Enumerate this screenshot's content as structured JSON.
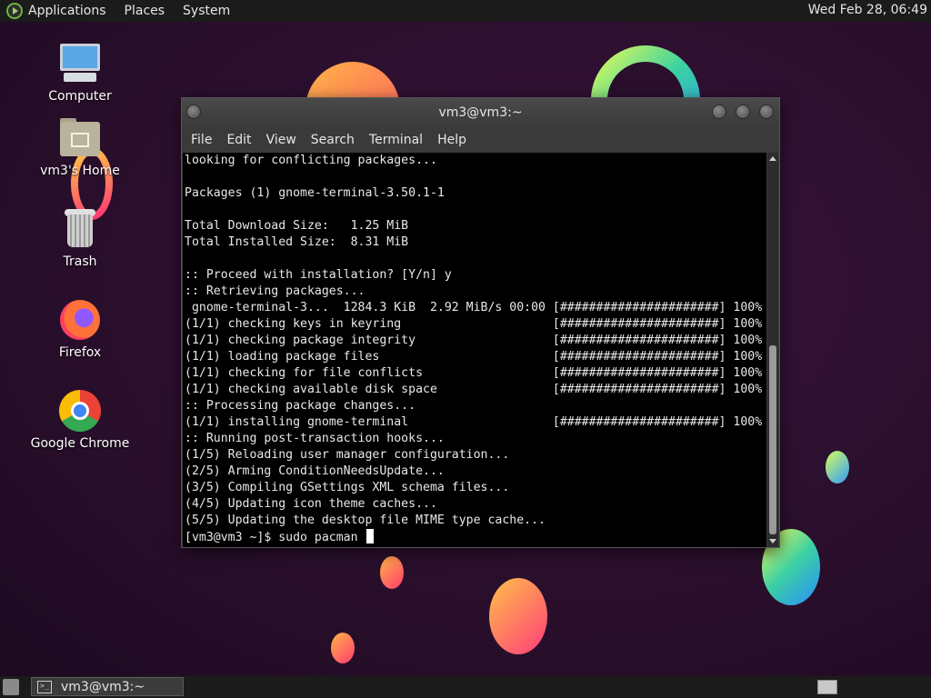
{
  "top_panel": {
    "menus": [
      "Applications",
      "Places",
      "System"
    ],
    "clock": "Wed Feb 28, 06:49"
  },
  "desktop_icons": [
    {
      "label": "Computer",
      "icon": "computer-icon"
    },
    {
      "label": "vm3's Home",
      "icon": "home-folder-icon"
    },
    {
      "label": "Trash",
      "icon": "trash-icon"
    },
    {
      "label": "Firefox",
      "icon": "firefox-icon"
    },
    {
      "label": "Google Chrome",
      "icon": "chrome-icon"
    }
  ],
  "terminal": {
    "title": "vm3@vm3:~",
    "menu": [
      "File",
      "Edit",
      "View",
      "Search",
      "Terminal",
      "Help"
    ],
    "lines": [
      "looking for conflicting packages...",
      "",
      "Packages (1) gnome-terminal-3.50.1-1",
      "",
      "Total Download Size:   1.25 MiB",
      "Total Installed Size:  8.31 MiB",
      "",
      ":: Proceed with installation? [Y/n] y",
      ":: Retrieving packages...",
      " gnome-terminal-3...  1284.3 KiB  2.92 MiB/s 00:00 [######################] 100%",
      "(1/1) checking keys in keyring                     [######################] 100%",
      "(1/1) checking package integrity                   [######################] 100%",
      "(1/1) loading package files                        [######################] 100%",
      "(1/1) checking for file conflicts                  [######################] 100%",
      "(1/1) checking available disk space                [######################] 100%",
      ":: Processing package changes...",
      "(1/1) installing gnome-terminal                    [######################] 100%",
      ":: Running post-transaction hooks...",
      "(1/5) Reloading user manager configuration...",
      "(2/5) Arming ConditionNeedsUpdate...",
      "(3/5) Compiling GSettings XML schema files...",
      "(4/5) Updating icon theme caches...",
      "(5/5) Updating the desktop file MIME type cache..."
    ],
    "prompt": "[vm3@vm3 ~]$ sudo pacman "
  },
  "taskbar": {
    "tasks": [
      {
        "label": "vm3@vm3:~",
        "icon": "terminal-icon"
      }
    ]
  }
}
